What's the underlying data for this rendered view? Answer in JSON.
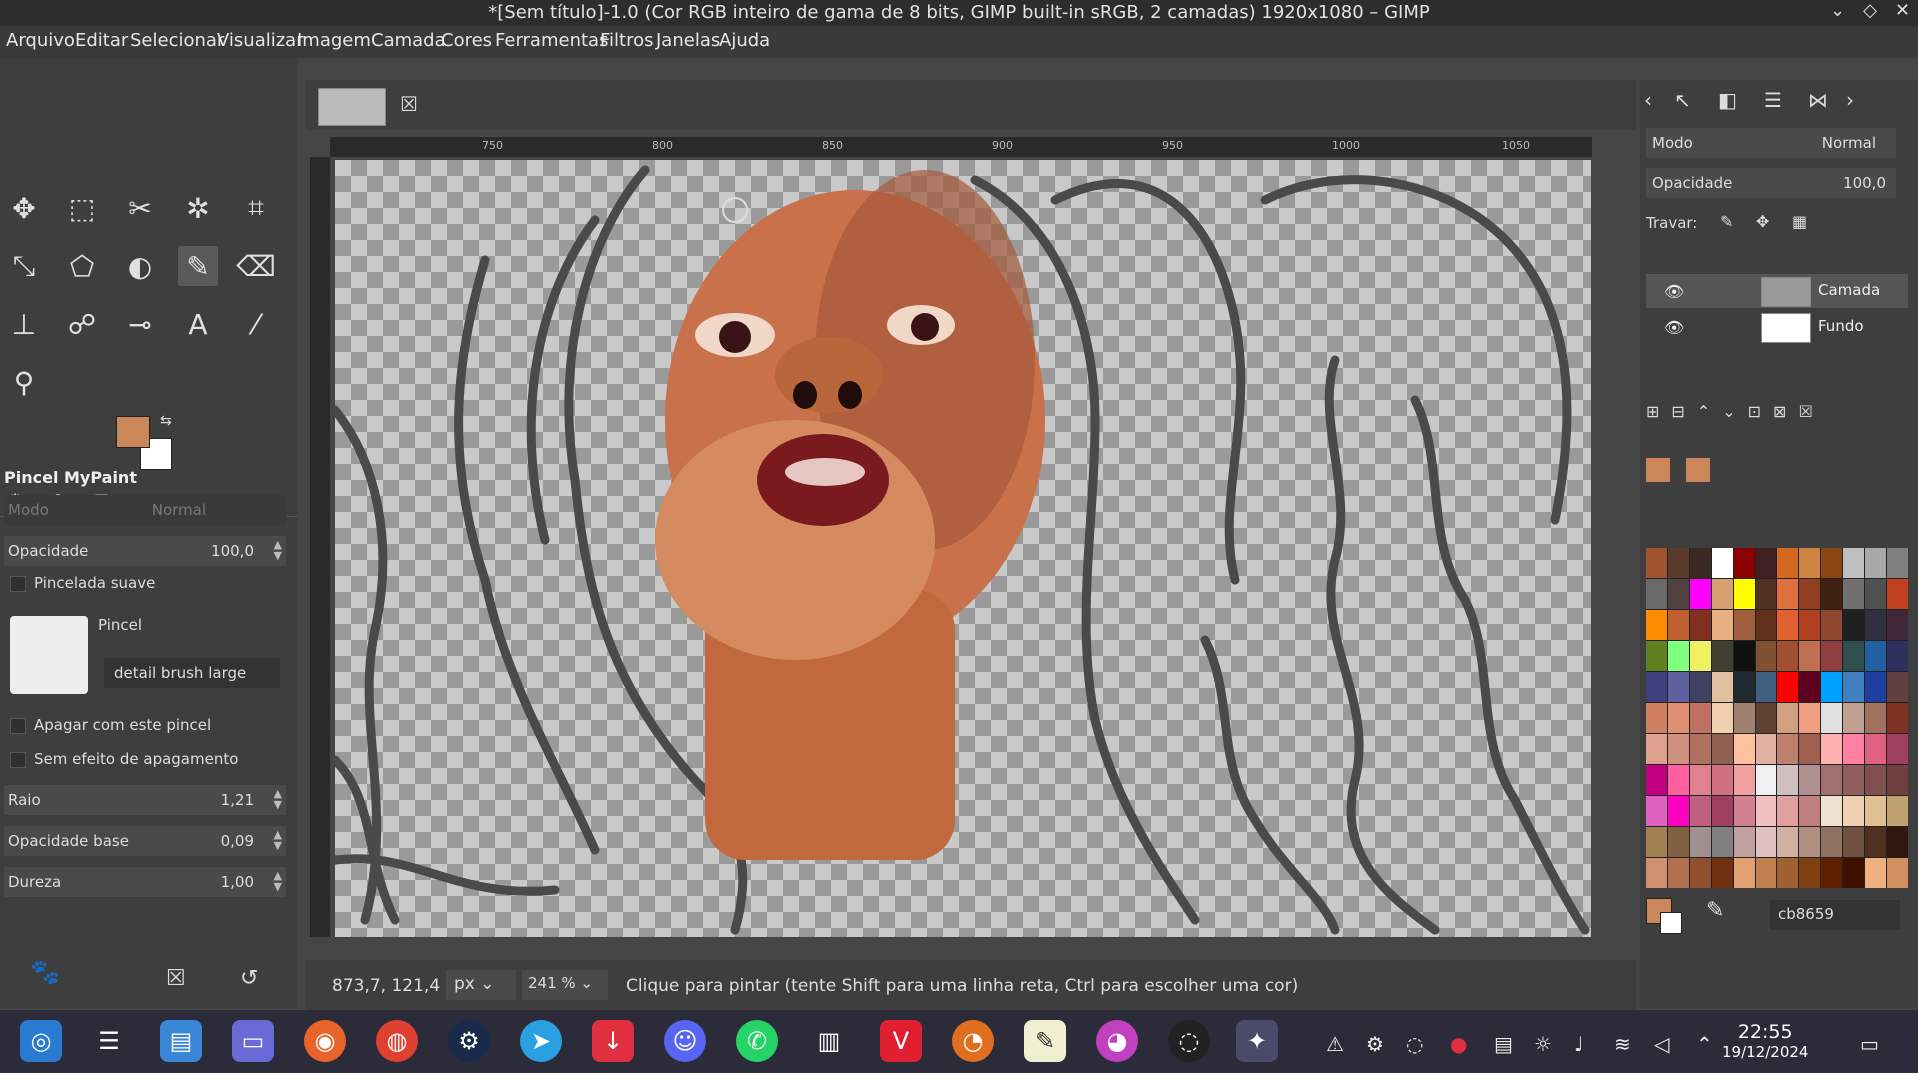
{
  "window": {
    "title": "*[Sem título]-1.0 (Cor RGB inteiro de gama de 8 bits, GIMP built-in sRGB, 2 camadas) 1920x1080 – GIMP"
  },
  "menu": [
    "Arquivo",
    "Editar",
    "Selecionar",
    "Visualizar",
    "Imagem",
    "Camada",
    "Cores",
    "Ferramentas",
    "Filtros",
    "Janelas",
    "Ajuda"
  ],
  "tool_options": {
    "title": "Pincel MyPaint",
    "mode_label": "Modo",
    "mode_value": "Normal",
    "opacity_label": "Opacidade",
    "opacity_value": "100,0",
    "smooth_label": "Pincelada suave",
    "brush_label": "Pincel",
    "brush_name": "detail brush large",
    "erase_label": "Apagar com este pincel",
    "no_erase_label": "Sem efeito de apagamento",
    "radius_label": "Raio",
    "radius_value": "1,21",
    "base_opacity_label": "Opacidade base",
    "base_opacity_value": "0,09",
    "hardness_label": "Dureza",
    "hardness_value": "1,00"
  },
  "ruler": {
    "h_ticks": [
      "750",
      "800",
      "850",
      "900",
      "950",
      "1000",
      "1050"
    ]
  },
  "status": {
    "coords": "873,7, 121,4",
    "unit": "px",
    "zoom": "241 %",
    "message": "Clique para pintar (tente Shift para uma linha reta, Ctrl para escolher uma cor)"
  },
  "layers_panel": {
    "mode_label": "Modo",
    "mode_value": "Normal",
    "opacity_label": "Opacidade",
    "opacity_value": "100,0",
    "lock_label": "Travar:",
    "layers": [
      {
        "name": "Camada"
      },
      {
        "name": "Fundo"
      }
    ]
  },
  "colors": {
    "fg": "#cb8659",
    "bg": "#ffffff",
    "hex_value": "cb8659",
    "palette": [
      "#a0522d",
      "#5a3a2a",
      "#3c2a22",
      "#ffffff",
      "#8b0000",
      "#402020",
      "#d2691e",
      "#cd853f",
      "#8b4513",
      "#c0c0c0",
      "#a9a9a9",
      "#808080",
      "#696969",
      "#504040",
      "#ff00ff",
      "#d4a070",
      "#ffff00",
      "#503020",
      "#e07040",
      "#904020",
      "#402010",
      "#707070",
      "#505050",
      "#c04020",
      "#ff8c00",
      "#c06030",
      "#803020",
      "#e8b080",
      "#a06040",
      "#603018",
      "#e06030",
      "#b04020",
      "#904830",
      "#202020",
      "#303040",
      "#402838",
      "#608020",
      "#80ff80",
      "#f0f060",
      "#404030",
      "#101010",
      "#805030",
      "#a05030",
      "#c07050",
      "#904040",
      "#305050",
      "#2060a0",
      "#303060",
      "#404080",
      "#6060a0",
      "#404060",
      "#e0c0a0",
      "#202830",
      "#406080",
      "#ff0000",
      "#600020",
      "#00a0ff",
      "#4080c0",
      "#2040a0",
      "#604040",
      "#d08060",
      "#e09070",
      "#c07060",
      "#f0d0b0",
      "#a08070",
      "#604030",
      "#d0a080",
      "#f0a080",
      "#e0e0e0",
      "#c0a090",
      "#a07060",
      "#803020",
      "#e0a090",
      "#d09080",
      "#b07060",
      "#906050",
      "#ffc0a0",
      "#e0b0a0",
      "#c08070",
      "#a06050",
      "#ffb0b0",
      "#ff80a0",
      "#e06080",
      "#a04060",
      "#c00080",
      "#ff60a0",
      "#e08090",
      "#d07080",
      "#f0a0a0",
      "#f0f0f0",
      "#d0c0c0",
      "#b09090",
      "#a07070",
      "#906060",
      "#805050",
      "#704040",
      "#e060c0",
      "#ff00c0",
      "#c06080",
      "#a04060",
      "#d08090",
      "#f0c0c0",
      "#e0a0a0",
      "#c08080",
      "#f0e0d0",
      "#f0d0b0",
      "#e0c090",
      "#c0a070",
      "#a08050",
      "#806040",
      "#a09090",
      "#808080",
      "#c0a0a0",
      "#e0c0c0",
      "#d0b0a0",
      "#b09080",
      "#907060",
      "#705040",
      "#503020",
      "#301810",
      "#d09070",
      "#b07050",
      "#905030",
      "#703010",
      "#e0a070",
      "#c08050",
      "#a06030",
      "#804010",
      "#602000",
      "#401000",
      "#f0b080",
      "#d09060"
    ]
  },
  "taskbar": {
    "time": "22:55",
    "date": "19/12/2024"
  }
}
